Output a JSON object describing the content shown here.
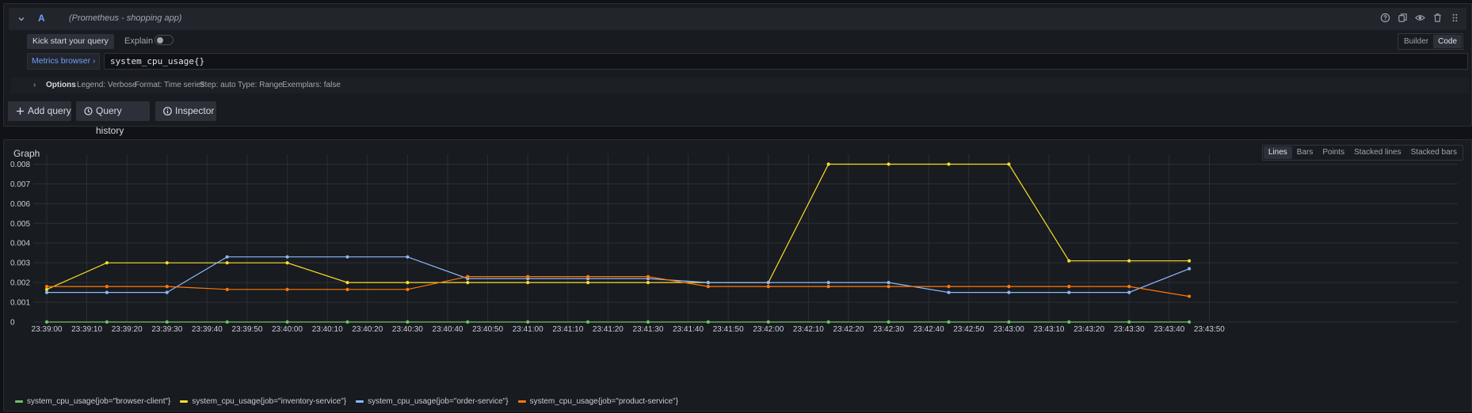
{
  "query": {
    "ref_id": "A",
    "datasource": "(Prometheus - shopping app)",
    "kick_start_label": "Kick start your query",
    "explain_label": "Explain",
    "explain_on": false,
    "modes": [
      "Builder",
      "Code"
    ],
    "active_mode": "Code",
    "metrics_browser_label": "Metrics browser",
    "expression": "system_cpu_usage{}",
    "options_label": "Options",
    "options": {
      "legend": "Legend: Verbose",
      "format": "Format: Time series",
      "step": "Step: auto",
      "type": "Type: Range",
      "exemplars": "Exemplars: false"
    },
    "header_icons": [
      "help-icon",
      "duplicate-icon",
      "eye-icon",
      "trash-icon",
      "drag-handle-icon"
    ]
  },
  "actions": {
    "add_query": "Add query",
    "query_history": "Query history",
    "inspector": "Inspector"
  },
  "graph": {
    "title": "Graph",
    "chart_types": [
      "Lines",
      "Bars",
      "Points",
      "Stacked lines",
      "Stacked bars"
    ],
    "active_chart_type": "Lines"
  },
  "chart_data": {
    "type": "line",
    "title": "",
    "xlabel": "",
    "ylabel": "",
    "ylim": [
      0,
      0.0085
    ],
    "x_ticks": [
      "23:39:00",
      "23:39:10",
      "23:39:20",
      "23:39:30",
      "23:39:40",
      "23:39:50",
      "23:40:00",
      "23:40:10",
      "23:40:20",
      "23:40:30",
      "23:40:40",
      "23:40:50",
      "23:41:00",
      "23:41:10",
      "23:41:20",
      "23:41:30",
      "23:41:40",
      "23:41:50",
      "23:42:00",
      "23:42:10",
      "23:42:20",
      "23:42:30",
      "23:42:40",
      "23:42:50",
      "23:43:00",
      "23:43:10",
      "23:43:20",
      "23:43:30",
      "23:43:40",
      "23:43:50"
    ],
    "y_ticks": [
      "0",
      "0.001",
      "0.002",
      "0.003",
      "0.004",
      "0.005",
      "0.006",
      "0.007",
      "0.008"
    ],
    "x": [
      "23:39:00",
      "23:39:15",
      "23:39:30",
      "23:39:45",
      "23:40:00",
      "23:40:15",
      "23:40:30",
      "23:40:45",
      "23:41:00",
      "23:41:15",
      "23:41:30",
      "23:41:45",
      "23:42:00",
      "23:42:15",
      "23:42:30",
      "23:42:45",
      "23:43:00",
      "23:43:15",
      "23:43:30",
      "23:43:45"
    ],
    "grid": true,
    "legend_position": "bottom",
    "series": [
      {
        "name": "system_cpu_usage{job=\"browser-client\"}",
        "color": "#73bf69",
        "values": [
          0,
          0,
          0,
          0,
          0,
          0,
          0,
          0,
          0,
          0,
          0,
          0,
          0,
          0,
          0,
          0,
          0,
          0,
          0,
          0
        ]
      },
      {
        "name": "system_cpu_usage{job=\"inventory-service\"}",
        "color": "#fade2a",
        "values": [
          0.00165,
          0.003,
          0.003,
          0.003,
          0.003,
          0.002,
          0.002,
          0.002,
          0.002,
          0.002,
          0.002,
          0.002,
          0.002,
          0.008,
          0.008,
          0.008,
          0.008,
          0.0031,
          0.0031,
          0.0031
        ]
      },
      {
        "name": "system_cpu_usage{job=\"order-service\"}",
        "color": "#8ab8ff",
        "values": [
          0.0015,
          0.0015,
          0.0015,
          0.0033,
          0.0033,
          0.0033,
          0.0033,
          0.0022,
          0.0022,
          0.0022,
          0.0022,
          0.002,
          0.002,
          0.002,
          0.002,
          0.0015,
          0.0015,
          0.0015,
          0.0015,
          0.0027
        ]
      },
      {
        "name": "system_cpu_usage{job=\"product-service\"}",
        "color": "#ff780a",
        "values": [
          0.0018,
          0.0018,
          0.0018,
          0.00165,
          0.00165,
          0.00165,
          0.00165,
          0.0023,
          0.0023,
          0.0023,
          0.0023,
          0.0018,
          0.0018,
          0.0018,
          0.0018,
          0.0018,
          0.0018,
          0.0018,
          0.0018,
          0.0013
        ]
      }
    ]
  }
}
